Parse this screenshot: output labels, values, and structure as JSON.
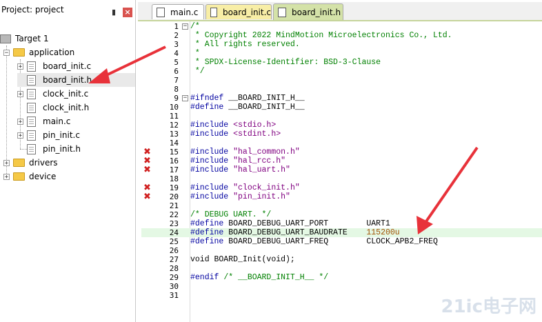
{
  "project": {
    "title": "Project: project",
    "target": "Target 1",
    "groups": [
      {
        "label": "application",
        "files": [
          "board_init.c",
          "board_init.h",
          "clock_init.c",
          "clock_init.h",
          "main.c",
          "pin_init.c",
          "pin_init.h"
        ]
      },
      {
        "label": "drivers"
      },
      {
        "label": "device"
      }
    ]
  },
  "tabs": [
    {
      "label": "main.c"
    },
    {
      "label": "board_init.c"
    },
    {
      "label": "board_init.h"
    }
  ],
  "editor": {
    "lines": [
      {
        "n": "1",
        "text": "/*"
      },
      {
        "n": "2",
        "text": " * Copyright 2022 MindMotion Microelectronics Co., Ltd."
      },
      {
        "n": "3",
        "text": " * All rights reserved."
      },
      {
        "n": "4",
        "text": " *"
      },
      {
        "n": "5",
        "text": " * SPDX-License-Identifier: BSD-3-Clause"
      },
      {
        "n": "6",
        "text": " */"
      },
      {
        "n": "7",
        "text": ""
      },
      {
        "n": "8",
        "text": ""
      },
      {
        "n": "9",
        "text": "#ifndef __BOARD_INIT_H__"
      },
      {
        "n": "10",
        "text": "#define __BOARD_INIT_H__"
      },
      {
        "n": "11",
        "text": ""
      },
      {
        "n": "12",
        "text": "#include <stdio.h>"
      },
      {
        "n": "13",
        "text": "#include <stdint.h>"
      },
      {
        "n": "14",
        "text": ""
      },
      {
        "n": "15",
        "text": "#include \"hal_common.h\""
      },
      {
        "n": "16",
        "text": "#include \"hal_rcc.h\""
      },
      {
        "n": "17",
        "text": "#include \"hal_uart.h\""
      },
      {
        "n": "18",
        "text": ""
      },
      {
        "n": "19",
        "text": "#include \"clock_init.h\""
      },
      {
        "n": "20",
        "text": "#include \"pin_init.h\""
      },
      {
        "n": "21",
        "text": ""
      },
      {
        "n": "22",
        "text": "/* DEBUG UART. */"
      },
      {
        "n": "23",
        "text": "#define BOARD_DEBUG_UART_PORT        UART1"
      },
      {
        "n": "24",
        "text": "#define BOARD_DEBUG_UART_BAUDRATE    115200u"
      },
      {
        "n": "25",
        "text": "#define BOARD_DEBUG_UART_FREQ        CLOCK_APB2_FREQ"
      },
      {
        "n": "26",
        "text": ""
      },
      {
        "n": "27",
        "text": "void BOARD_Init(void);"
      },
      {
        "n": "28",
        "text": ""
      },
      {
        "n": "29",
        "text": "#endif /* __BOARD_INIT_H__ */"
      },
      {
        "n": "30",
        "text": ""
      },
      {
        "n": "31",
        "text": ""
      }
    ],
    "error_lines": [
      "15",
      "16",
      "17",
      "19",
      "20"
    ],
    "highlighted_line": "24"
  },
  "watermark": "21ic电子网",
  "colors": {
    "comment": "#008000",
    "preprocessor": "#0000a0",
    "string": "#800080",
    "error": "#d02020",
    "arrow": "#e8323a",
    "active_tab": "#f5f0b5"
  }
}
